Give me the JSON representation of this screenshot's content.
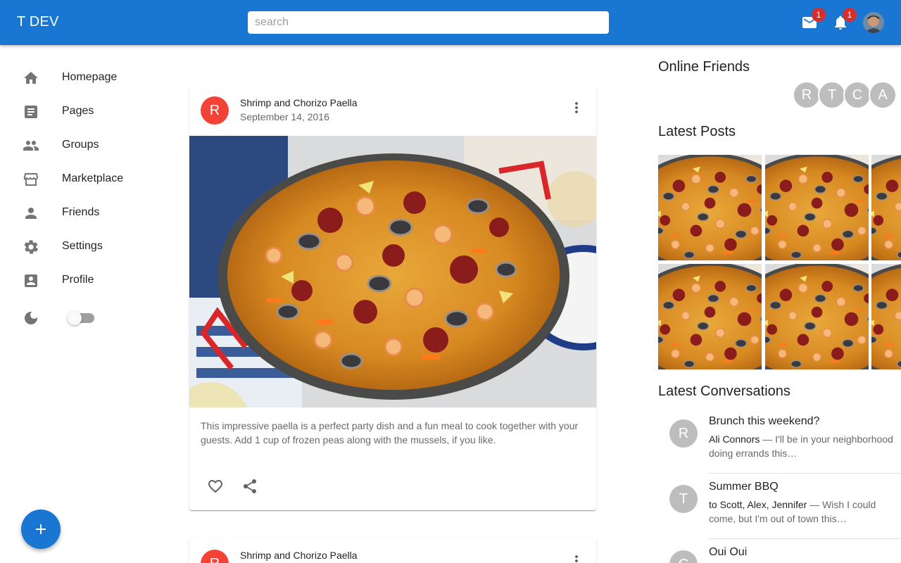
{
  "appbar": {
    "logo": "T DEV",
    "search_placeholder": "search",
    "mail_badge": "1",
    "notifications_badge": "1"
  },
  "sidebar": {
    "items": [
      {
        "label": "Homepage",
        "icon": "home-icon"
      },
      {
        "label": "Pages",
        "icon": "article-icon"
      },
      {
        "label": "Groups",
        "icon": "group-icon"
      },
      {
        "label": "Marketplace",
        "icon": "storefront-icon"
      },
      {
        "label": "Friends",
        "icon": "person-icon"
      },
      {
        "label": "Settings",
        "icon": "gear-icon"
      },
      {
        "label": "Profile",
        "icon": "account-box-icon"
      }
    ],
    "dark_mode_enabled": false
  },
  "posts": [
    {
      "avatar_letter": "R",
      "title": "Shrimp and Chorizo Paella",
      "date": "September 14, 2016",
      "text": "This impressive paella is a perfect party dish and a fun meal to cook together with your guests. Add 1 cup of frozen peas along with the mussels, if you like."
    },
    {
      "avatar_letter": "R",
      "title": "Shrimp and Chorizo Paella"
    }
  ],
  "right_panel": {
    "online_friends_title": "Online Friends",
    "online_friends": [
      "R",
      "T",
      "C",
      "A"
    ],
    "latest_posts_title": "Latest Posts",
    "latest_conversations_title": "Latest Conversations",
    "conversations": [
      {
        "letter": "R",
        "title": "Brunch this weekend?",
        "from": "Ali Connors",
        "snippet": " — I'll be in your neighborhood doing errands this…"
      },
      {
        "letter": "T",
        "title": "Summer BBQ",
        "from": "to Scott, Alex, Jennifer",
        "snippet": " — Wish I could come, but I'm out of town this…"
      },
      {
        "letter": "C",
        "title": "Oui Oui"
      }
    ]
  },
  "colors": {
    "primary": "#1976d2",
    "badge": "#d32f2f",
    "post_avatar": "#f44336",
    "friend_avatar": "#bdbdbd"
  }
}
